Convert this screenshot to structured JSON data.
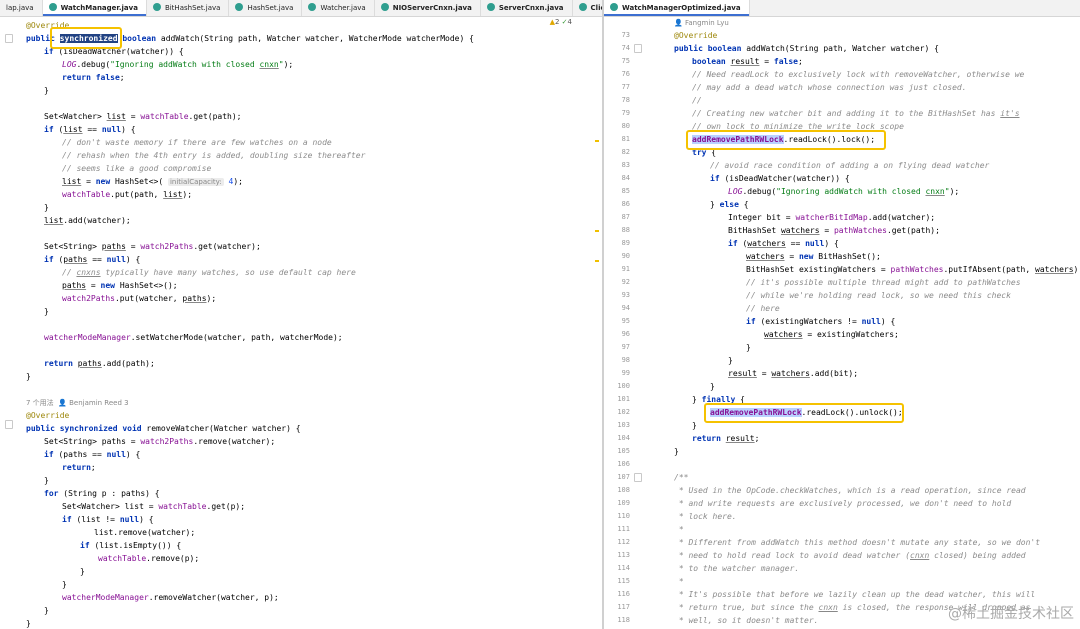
{
  "left_editor": {
    "tabs": [
      "lap.java",
      "WatchManager.java",
      "BitHashSet.java",
      "HashSet.java",
      "Watcher.java",
      "NIOServerCnxn.java",
      "ServerCnxn.java",
      "ClientC"
    ],
    "inspection": {
      "warnings": "2",
      "checks": "4"
    },
    "usages": "7 个用法",
    "author": "Benjamin Reed 3"
  },
  "right_editor": {
    "tab": "WatchManagerOptimized.java",
    "author": "Fangmin Lyu"
  },
  "watermark": "@稀土掘金技术社区",
  "colors": {
    "highlight_box": "#f5c200",
    "selection": "#214283",
    "keyword": "#0033b3"
  }
}
